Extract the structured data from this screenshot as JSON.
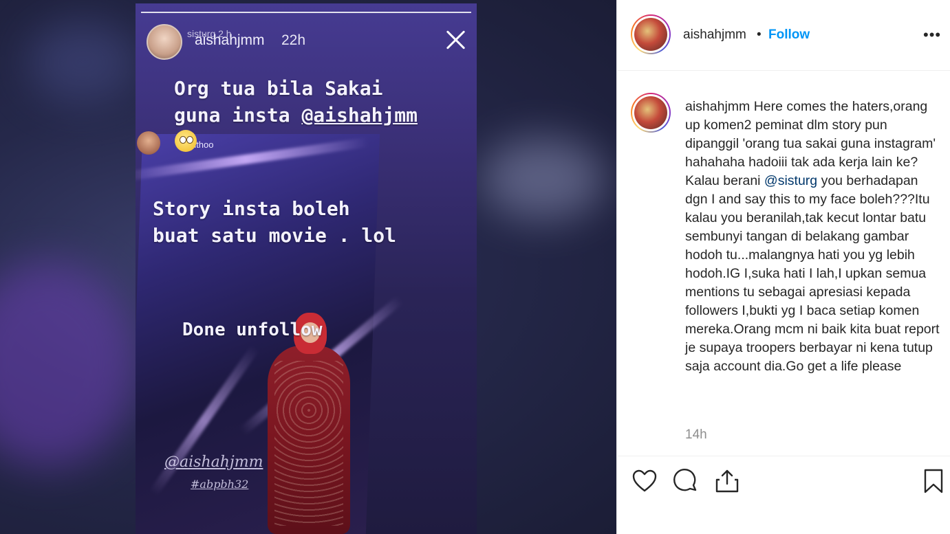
{
  "story": {
    "username": "aishahjmm",
    "username_overlap": "sisturg 2 h",
    "time": "22h",
    "text_1": "Org tua bila Sakai\nguna insta ",
    "text_1_mention": "@aishahjmm",
    "mini_user": "cannthoo",
    "text_2": "Story insta boleh\nbuat satu movie . lol",
    "text_3": "Done unfollow",
    "watermark_1": "@aishahjmm",
    "watermark_2": "#abpbh32"
  },
  "post": {
    "header": {
      "username": "aishahjmm",
      "separator": "•",
      "follow_label": "Follow",
      "more_label": "•••"
    },
    "caption": {
      "username": "aishahjmm",
      "text_before_mention": " Here comes the haters,orang up komen2 peminat dlm story pun dipanggil 'orang tua sakai guna instagram' hahahaha hadoiii tak ada kerja lain ke?Kalau berani ",
      "mention": "@sisturg",
      "text_after_mention": " you berhadapan dgn I and say this to my face boleh???Itu kalau you beranilah,tak kecut lontar batu sembunyi tangan di belakang gambar hodoh tu...malangnya hati you yg lebih hodoh.IG I,suka hati I lah,I upkan semua mentions tu sebagai apresiasi kepada followers I,bukti yg I baca setiap komen mereka.Orang mcm ni baik kita buat report je supaya troopers berbayar ni kena tutup saja account dia.Go get a life please"
    },
    "time": "14h",
    "actions": {
      "icons": [
        "heart-icon",
        "comment-icon",
        "share-icon",
        "bookmark-icon"
      ]
    }
  },
  "colors": {
    "follow": "#0095f6",
    "mention": "#00376b",
    "muted": "#8e8e8e",
    "text": "#262626"
  }
}
